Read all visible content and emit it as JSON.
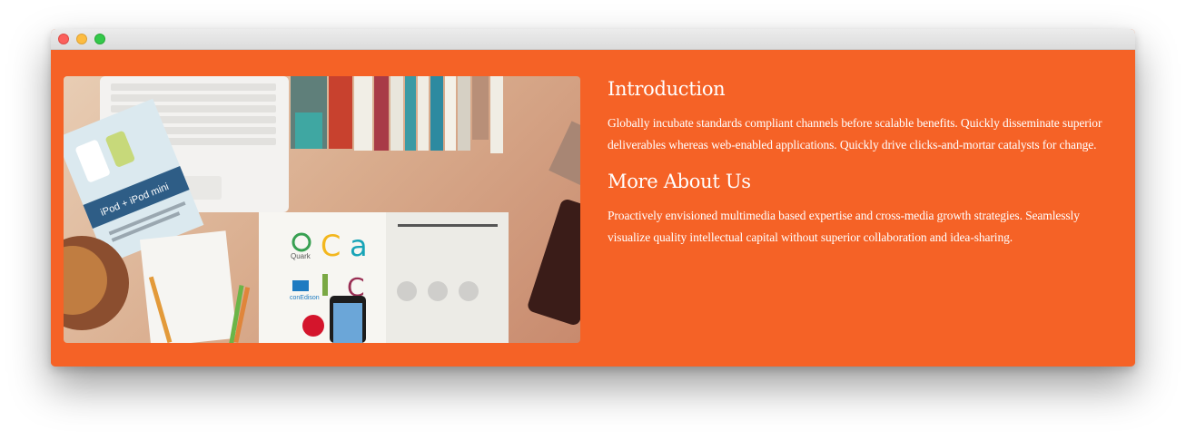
{
  "window": {
    "controls": {
      "close": "close-icon",
      "minimize": "minimize-icon",
      "zoom": "zoom-icon"
    }
  },
  "colors": {
    "background": "#f56226",
    "text": "#ffffff"
  },
  "photo": {
    "ipod_label": "iPod + iPod mini",
    "brand_quark": "Quark",
    "brand_conedison": "conEdison"
  },
  "sections": [
    {
      "title": "Introduction",
      "body": "Globally incubate standards compliant channels before scalable benefits. Quickly disseminate superior deliverables whereas web-enabled applications. Quickly drive clicks-and-mortar catalysts for change."
    },
    {
      "title": "More About Us",
      "body": "Proactively envisioned multimedia based expertise and cross-media growth strategies. Seamlessly visualize quality intellectual capital without superior collaboration and idea-sharing."
    }
  ]
}
